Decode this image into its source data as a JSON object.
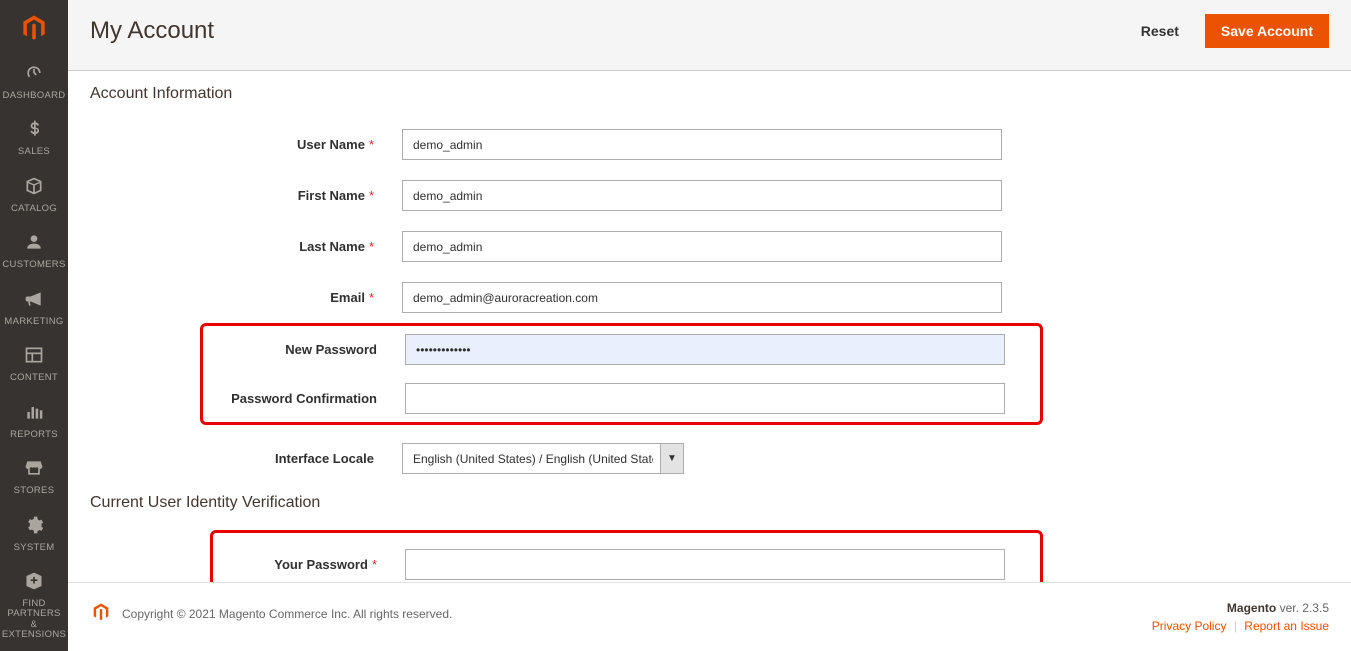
{
  "sidebar": {
    "items": [
      {
        "label": "DASHBOARD"
      },
      {
        "label": "SALES"
      },
      {
        "label": "CATALOG"
      },
      {
        "label": "CUSTOMERS"
      },
      {
        "label": "MARKETING"
      },
      {
        "label": "CONTENT"
      },
      {
        "label": "REPORTS"
      },
      {
        "label": "STORES"
      },
      {
        "label": "SYSTEM"
      },
      {
        "label": "FIND PARTNERS\n& EXTENSIONS"
      }
    ]
  },
  "header": {
    "title": "My Account",
    "reset": "Reset",
    "save": "Save Account"
  },
  "sections": {
    "account_info": "Account Information",
    "identity": "Current User Identity Verification"
  },
  "fields": {
    "username": {
      "label": "User Name",
      "value": "demo_admin"
    },
    "firstname": {
      "label": "First Name",
      "value": "demo_admin"
    },
    "lastname": {
      "label": "Last Name",
      "value": "demo_admin"
    },
    "email": {
      "label": "Email",
      "value": "demo_admin@auroracreation.com"
    },
    "newpassword": {
      "label": "New Password",
      "value": "•••••••••••••"
    },
    "confirmpassword": {
      "label": "Password Confirmation",
      "value": ""
    },
    "locale": {
      "label": "Interface Locale",
      "value": "English (United States) / English (United States)"
    },
    "yourpassword": {
      "label": "Your Password",
      "value": ""
    }
  },
  "footer": {
    "copyright": "Copyright © 2021 Magento Commerce Inc. All rights reserved.",
    "product": "Magento",
    "ver_label": "ver.",
    "version": "2.3.5",
    "privacy": "Privacy Policy",
    "report": "Report an Issue"
  }
}
